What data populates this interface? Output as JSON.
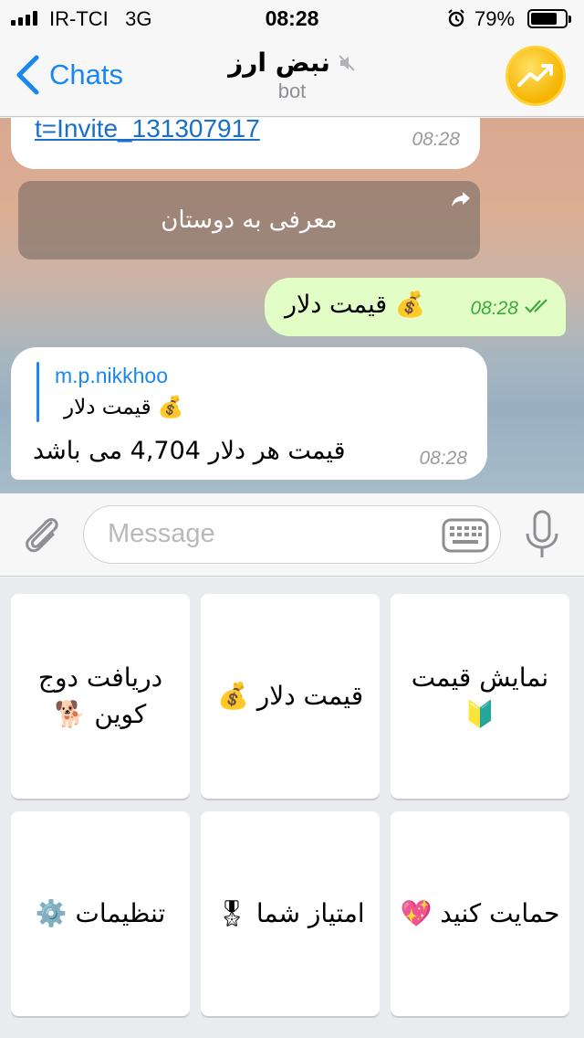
{
  "status_bar": {
    "carrier": "IR-TCI",
    "network": "3G",
    "time": "08:28",
    "battery": "79%",
    "battery_level": 0.79
  },
  "header": {
    "back_label": "Chats",
    "title": "نبض ارز",
    "subtitle": "bot",
    "muted_icon": "speaker-muted-icon",
    "avatar_icon": "trending-up-icon",
    "avatar_color": "#f5b400"
  },
  "messages": [
    {
      "type": "incoming",
      "text": "t=Invite_131307917",
      "time": "08:28"
    },
    {
      "type": "inline_button",
      "label": "معرفی به دوستان"
    },
    {
      "type": "outgoing",
      "text": "قیمت دلار 💰",
      "time": "08:28"
    },
    {
      "type": "incoming_reply",
      "reply_author": "m.p.nikkhoo",
      "reply_text": "قیمت دلار 💰",
      "text": "قیمت هر دلار 4,704 می باشد",
      "time": "08:28"
    }
  ],
  "input": {
    "placeholder": "Message"
  },
  "keyboard": {
    "buttons": [
      "دریافت دوج کوین 🐕",
      "قیمت دلار 💰",
      "نمایش قیمت 🔰",
      "تنظیمات ⚙️",
      "امتیاز شما 🎖",
      "حمایت کنید 💖"
    ]
  },
  "colors": {
    "accent": "#1a87f0",
    "outgoing_bubble": "#e2fec6",
    "read_check": "#3da93d"
  }
}
